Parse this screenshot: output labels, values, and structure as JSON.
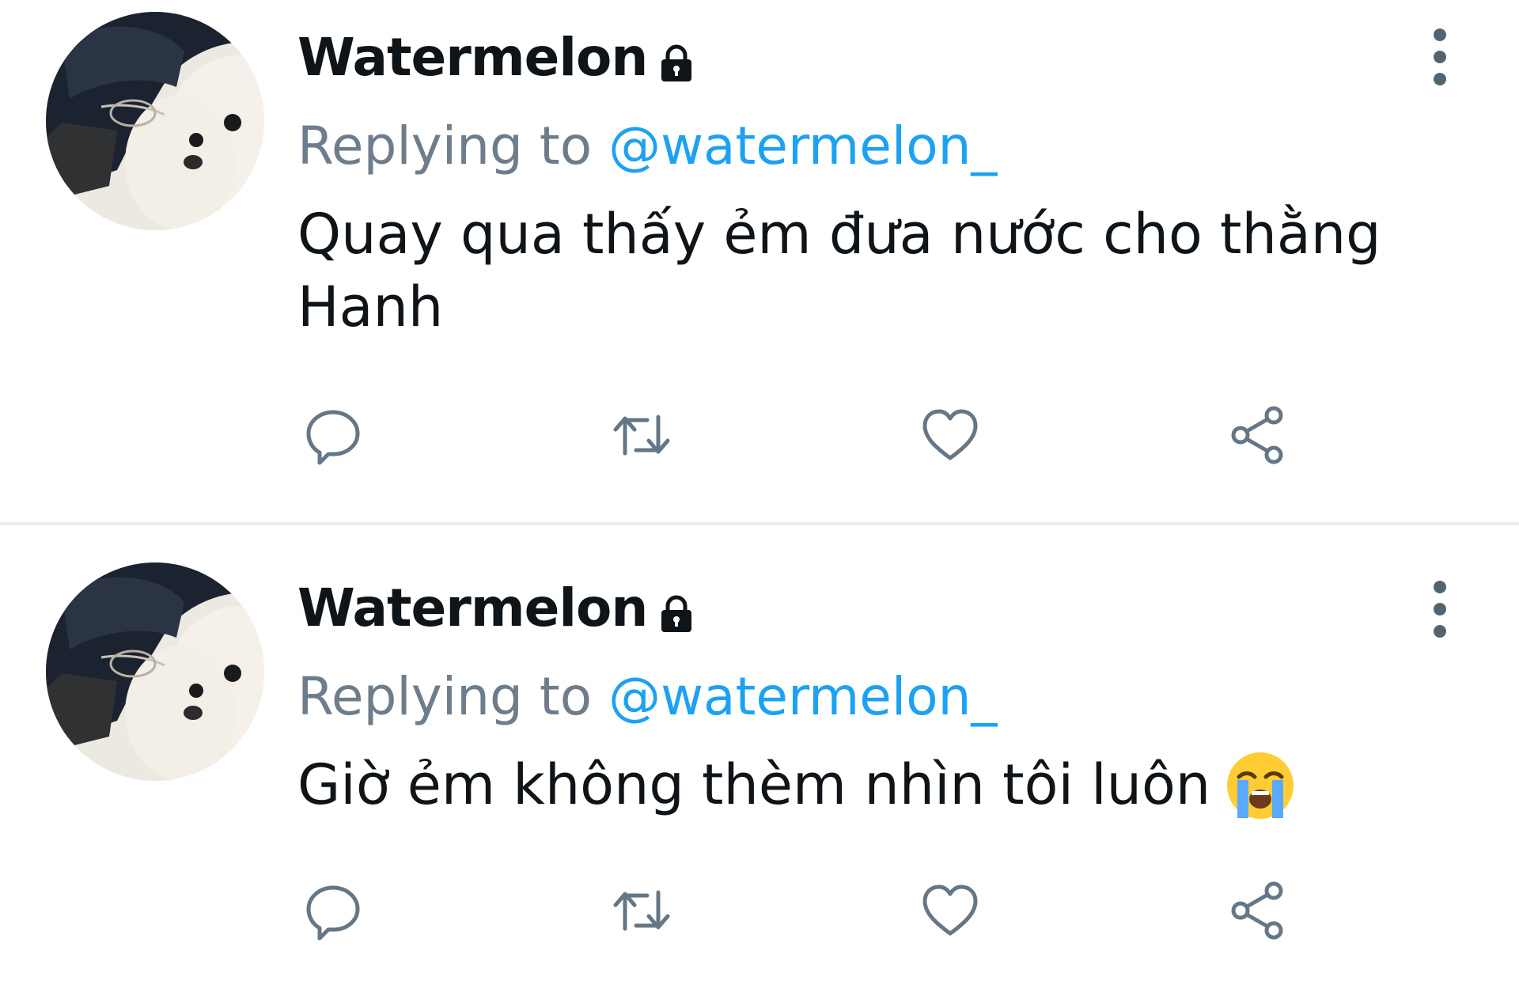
{
  "colors": {
    "text": "#0f1419",
    "secondary": "#6e7d8b",
    "accent": "#1da1f2",
    "divider": "#e6ecf0",
    "icon": "#657786"
  },
  "tweets": [
    {
      "display_name": "Watermelon",
      "protected_icon": "lock-icon",
      "replying_prefix": "Replying to",
      "replying_handle": "@watermelon_",
      "text": "Quay qua thấy ẻm đưa nước cho thằng Hanh",
      "actions": [
        "reply-icon",
        "retweet-icon",
        "like-icon",
        "share-icon"
      ]
    },
    {
      "display_name": "Watermelon",
      "protected_icon": "lock-icon",
      "replying_prefix": "Replying to",
      "replying_handle": "@watermelon_",
      "text": "Giờ ẻm không thèm nhìn tôi luôn",
      "emoji": "loudly-crying-face-emoji",
      "actions": [
        "reply-icon",
        "retweet-icon",
        "like-icon",
        "share-icon"
      ]
    }
  ]
}
